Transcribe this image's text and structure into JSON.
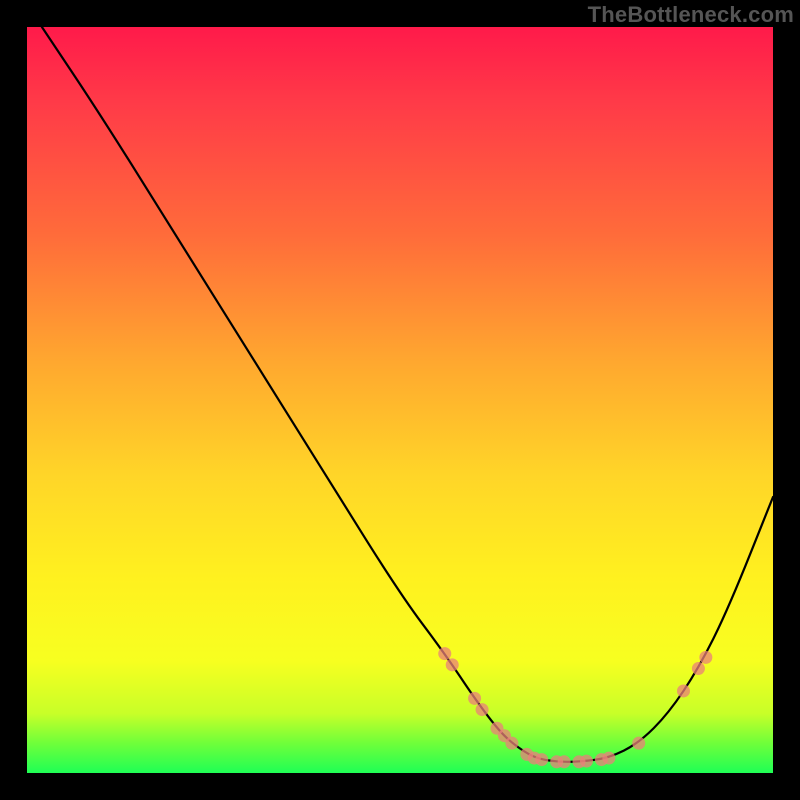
{
  "watermark": "TheBottleneck.com",
  "chart_data": {
    "type": "line",
    "title": "",
    "xlabel": "",
    "ylabel": "",
    "xlim": [
      0,
      100
    ],
    "ylim": [
      0,
      100
    ],
    "series": [
      {
        "name": "curve",
        "x": [
          2,
          10,
          20,
          30,
          40,
          50,
          56,
          60,
          63,
          65,
          68,
          71,
          74,
          78,
          82,
          86,
          90,
          94,
          100
        ],
        "y": [
          100,
          88,
          72,
          56,
          40,
          24,
          16,
          10,
          6,
          4,
          2,
          1.5,
          1.5,
          2,
          4,
          8,
          14,
          22,
          37
        ]
      }
    ],
    "markers": [
      {
        "x": 56,
        "y": 16
      },
      {
        "x": 57,
        "y": 14.5
      },
      {
        "x": 60,
        "y": 10
      },
      {
        "x": 61,
        "y": 8.5
      },
      {
        "x": 63,
        "y": 6
      },
      {
        "x": 64,
        "y": 5
      },
      {
        "x": 65,
        "y": 4
      },
      {
        "x": 67,
        "y": 2.5
      },
      {
        "x": 68,
        "y": 2
      },
      {
        "x": 69,
        "y": 1.8
      },
      {
        "x": 71,
        "y": 1.5
      },
      {
        "x": 72,
        "y": 1.5
      },
      {
        "x": 74,
        "y": 1.5
      },
      {
        "x": 75,
        "y": 1.6
      },
      {
        "x": 77,
        "y": 1.8
      },
      {
        "x": 78,
        "y": 2
      },
      {
        "x": 82,
        "y": 4
      },
      {
        "x": 88,
        "y": 11
      },
      {
        "x": 90,
        "y": 14
      },
      {
        "x": 91,
        "y": 15.5
      }
    ],
    "gradient_stops": [
      {
        "pos": 0,
        "color": "#ff1a4a"
      },
      {
        "pos": 28,
        "color": "#ff6c3a"
      },
      {
        "pos": 60,
        "color": "#ffd528"
      },
      {
        "pos": 85,
        "color": "#f7ff20"
      },
      {
        "pos": 100,
        "color": "#1fff55"
      }
    ]
  }
}
